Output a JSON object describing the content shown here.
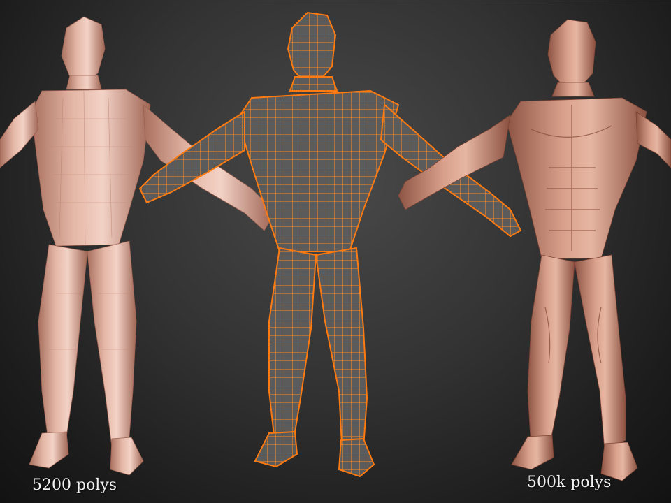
{
  "models": [
    {
      "caption": "5200 polys",
      "shading": "low-poly",
      "color": "#d6a28e"
    },
    {
      "caption": "",
      "shading": "wireframe",
      "color": "#6e6e6e",
      "wire_color": "#ff8a1f"
    },
    {
      "caption": "500k polys",
      "shading": "high-detail",
      "color": "#c98d76"
    }
  ]
}
